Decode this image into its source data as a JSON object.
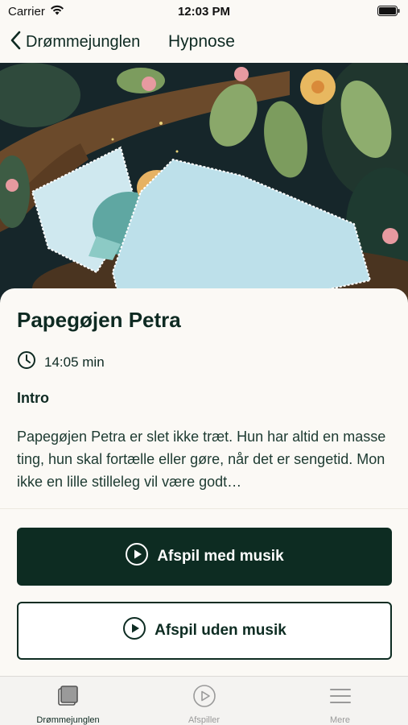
{
  "status_bar": {
    "carrier": "Carrier",
    "time": "12:03 PM"
  },
  "nav": {
    "back_label": "Drømmejunglen",
    "title": "Hypnose"
  },
  "story": {
    "title": "Papegøjen Petra",
    "duration": "14:05 min",
    "section_heading": "Intro",
    "description": "Papegøjen Petra er slet ikke træt. Hun har altid en masse ting, hun skal fortælle eller gøre, når det er sengetid. Mon ikke en lille stilleleg vil være godt…"
  },
  "actions": {
    "play_with_music": "Afspil med musik",
    "play_without_music": "Afspil uden musik"
  },
  "tabs": [
    {
      "label": "Drømmejunglen",
      "icon": "library-icon",
      "active": true
    },
    {
      "label": "Afspiller",
      "icon": "play-circle-icon",
      "active": false
    },
    {
      "label": "Mere",
      "icon": "menu-icon",
      "active": false
    }
  ],
  "colors": {
    "primary": "#0d2c22",
    "background": "#fbf9f5",
    "tab_inactive": "#9a9a9a"
  }
}
